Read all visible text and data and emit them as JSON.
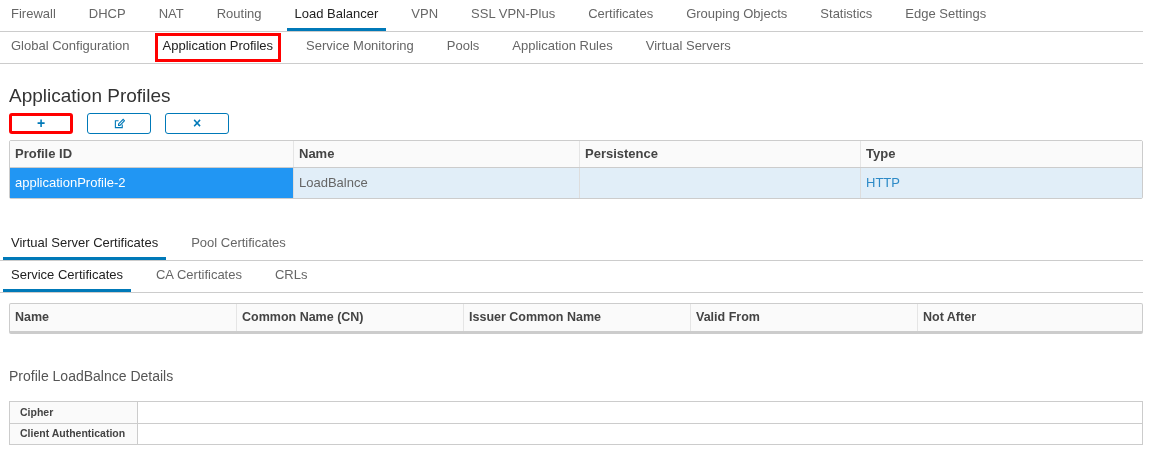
{
  "main_tabs": [
    {
      "label": "Firewall",
      "selected": false
    },
    {
      "label": "DHCP",
      "selected": false
    },
    {
      "label": "NAT",
      "selected": false
    },
    {
      "label": "Routing",
      "selected": false
    },
    {
      "label": "Load Balancer",
      "selected": true
    },
    {
      "label": "VPN",
      "selected": false
    },
    {
      "label": "SSL VPN-Plus",
      "selected": false
    },
    {
      "label": "Certificates",
      "selected": false
    },
    {
      "label": "Grouping Objects",
      "selected": false
    },
    {
      "label": "Statistics",
      "selected": false
    },
    {
      "label": "Edge Settings",
      "selected": false
    }
  ],
  "sub_tabs": [
    {
      "label": "Global Configuration",
      "selected": false,
      "highlighted": false
    },
    {
      "label": "Application Profiles",
      "selected": true,
      "highlighted": true
    },
    {
      "label": "Service Monitoring",
      "selected": false,
      "highlighted": false
    },
    {
      "label": "Pools",
      "selected": false,
      "highlighted": false
    },
    {
      "label": "Application Rules",
      "selected": false,
      "highlighted": false
    },
    {
      "label": "Virtual Servers",
      "selected": false,
      "highlighted": false
    }
  ],
  "title": "Application Profiles",
  "toolbar": [
    {
      "kind": "add",
      "label": "+",
      "highlighted": true
    },
    {
      "kind": "edit",
      "highlighted": false
    },
    {
      "kind": "delete",
      "label": "×",
      "highlighted": false
    }
  ],
  "profiles_table": {
    "columns": [
      "Profile ID",
      "Name",
      "Persistence",
      "Type"
    ],
    "rows": [
      {
        "selected": true,
        "cells": [
          "applicationProfile-2",
          "LoadBalnce",
          "",
          "HTTP"
        ]
      }
    ]
  },
  "cert_tabs": [
    {
      "label": "Virtual Server Certificates",
      "selected": true
    },
    {
      "label": "Pool Certificates",
      "selected": false
    }
  ],
  "cert_sub_tabs": [
    {
      "label": "Service Certificates",
      "selected": true
    },
    {
      "label": "CA Certificates",
      "selected": false
    },
    {
      "label": "CRLs",
      "selected": false
    }
  ],
  "cert_table": {
    "columns": [
      "Name",
      "Common Name (CN)",
      "Issuer Common Name",
      "Valid From",
      "Not After"
    ]
  },
  "details": {
    "title": "Profile LoadBalnce Details",
    "rows": [
      "Cipher",
      "Client Authentication"
    ]
  }
}
